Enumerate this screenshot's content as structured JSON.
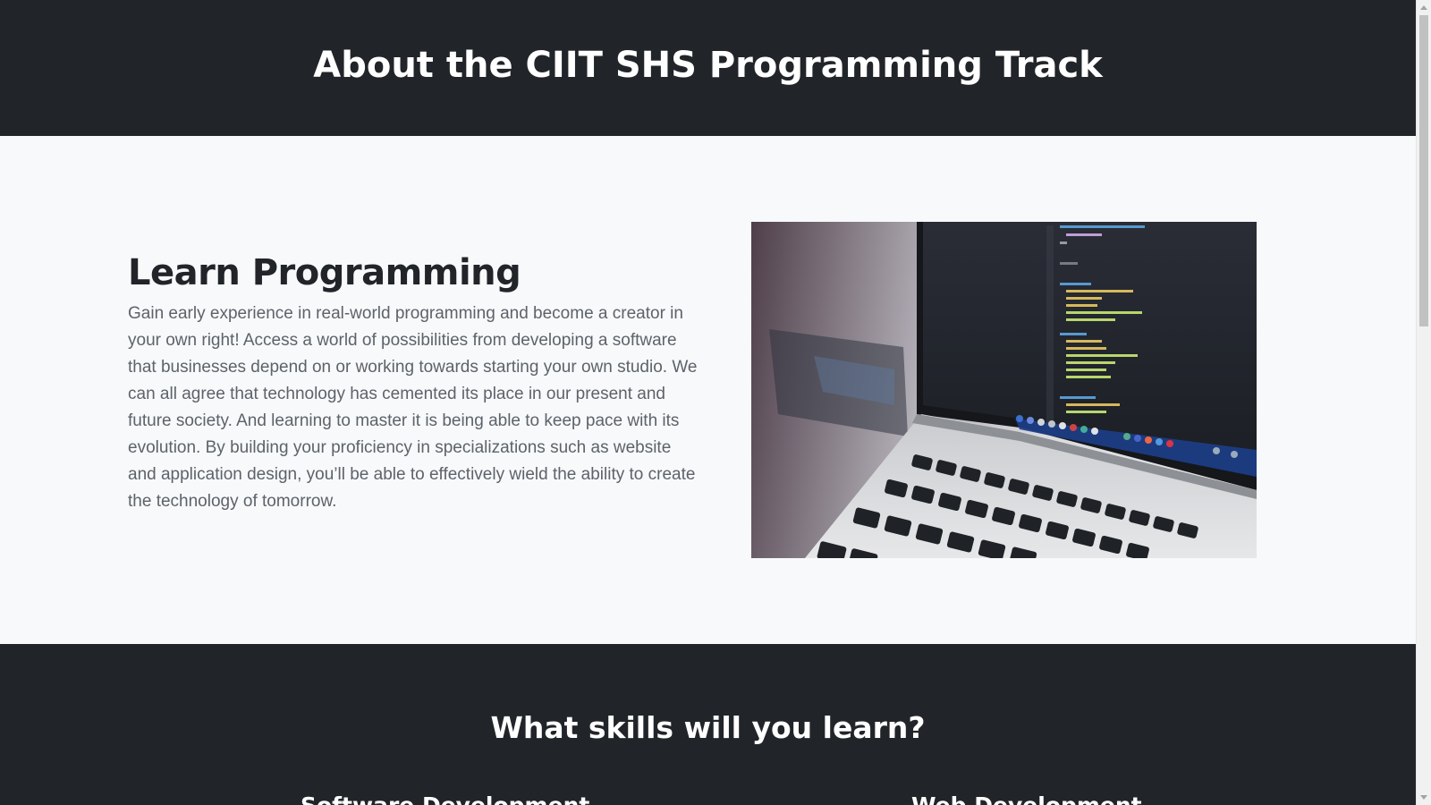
{
  "header": {
    "title": "About the CIIT SHS Programming Track"
  },
  "about": {
    "heading": "Learn Programming",
    "body": "Gain early experience in real-world programming and become a creator in your own right! Access a world of possibilities from developing a software that businesses depend on or working towards starting your own studio. We can all agree that technology has cemented its place in our present and future society. And learning to master it is being able to keep pace with its evolution. By building your proficiency in specializations such as website and application design, you’ll be able to effectively wield the ability to create the technology of tomorrow.",
    "image_alt": "laptop with code editor"
  },
  "skills": {
    "heading": "What skills will you learn?",
    "items": [
      {
        "title": "Software Development"
      },
      {
        "title": "Web Development"
      }
    ]
  },
  "colors": {
    "dark": "#212529",
    "light": "#f8f9fa",
    "body_text": "#5c636a"
  }
}
